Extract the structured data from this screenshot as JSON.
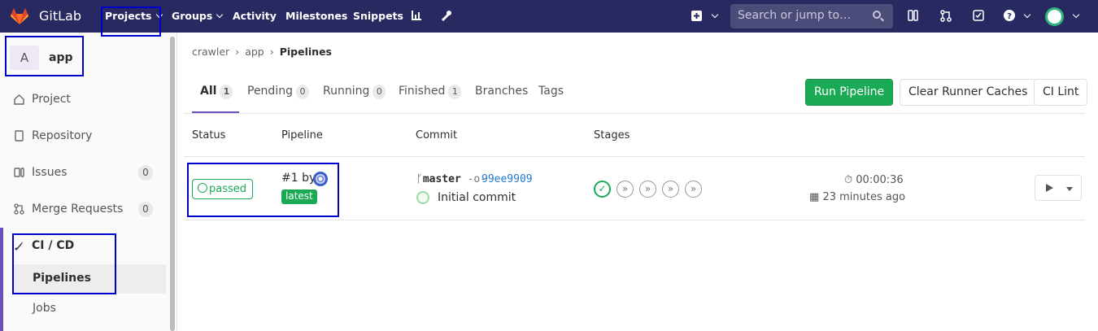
{
  "topnav": {
    "brand": "GitLab",
    "items": [
      "Projects",
      "Groups",
      "Activity",
      "Milestones",
      "Snippets"
    ],
    "search_placeholder": "Search or jump to…"
  },
  "sidebar": {
    "project_initial": "A",
    "project_name": "app",
    "items": [
      {
        "label": "Project"
      },
      {
        "label": "Repository"
      },
      {
        "label": "Issues",
        "count": "0"
      },
      {
        "label": "Merge Requests",
        "count": "0"
      },
      {
        "label": "CI / CD"
      }
    ],
    "subitems": [
      "Pipelines",
      "Jobs"
    ]
  },
  "breadcrumb": [
    "crawler",
    "app",
    "Pipelines"
  ],
  "tabs": [
    {
      "label": "All",
      "count": "1"
    },
    {
      "label": "Pending",
      "count": "0"
    },
    {
      "label": "Running",
      "count": "0"
    },
    {
      "label": "Finished",
      "count": "1"
    },
    {
      "label": "Branches"
    },
    {
      "label": "Tags"
    }
  ],
  "actions": {
    "run": "Run Pipeline",
    "clear": "Clear Runner Caches",
    "lint": "CI Lint"
  },
  "table": {
    "headers": [
      "Status",
      "Pipeline",
      "Commit",
      "Stages"
    ],
    "row": {
      "status": "passed",
      "pipeline_id": "#1 by",
      "latest": "latest",
      "ref": "master",
      "sha": "99ee9909",
      "message": "Initial commit",
      "duration": "00:00:36",
      "finished": "23 minutes ago"
    }
  },
  "colors": {
    "nav": "#292961",
    "accent": "#6b4fbb",
    "success": "#1aaa55",
    "link": "#1f78d1"
  }
}
